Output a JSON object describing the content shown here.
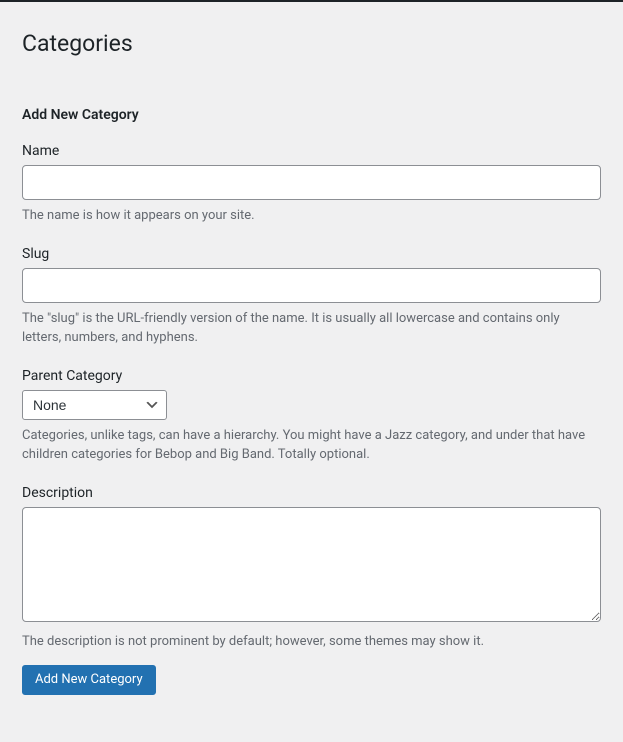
{
  "page": {
    "title": "Categories"
  },
  "form": {
    "heading": "Add New Category",
    "fields": {
      "name": {
        "label": "Name",
        "value": "",
        "help": "The name is how it appears on your site."
      },
      "slug": {
        "label": "Slug",
        "value": "",
        "help": "The \"slug\" is the URL-friendly version of the name. It is usually all lowercase and contains only letters, numbers, and hyphens."
      },
      "parent": {
        "label": "Parent Category",
        "selected": "None",
        "help": "Categories, unlike tags, can have a hierarchy. You might have a Jazz category, and under that have children categories for Bebop and Big Band. Totally optional."
      },
      "description": {
        "label": "Description",
        "value": "",
        "help": "The description is not prominent by default; however, some themes may show it."
      }
    },
    "submit_label": "Add New Category"
  }
}
